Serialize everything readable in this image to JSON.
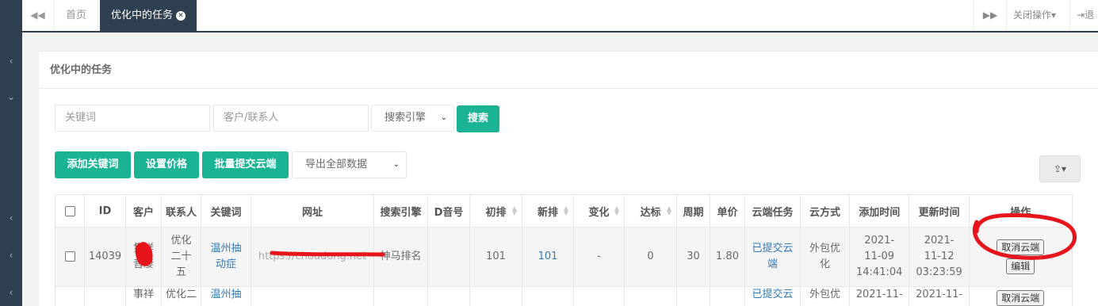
{
  "topbar": {
    "nav_back_icon": "double-left-arrow",
    "tabs": [
      {
        "label": "首页",
        "active": false
      },
      {
        "label": "优化中的任务",
        "active": true,
        "closable": true
      }
    ],
    "nav_forward_icon": "double-right-arrow",
    "close_ops_label": "关闭操作",
    "logout_label": "退"
  },
  "panel": {
    "title": "优化中的任务",
    "search": {
      "keyword_placeholder": "关键词",
      "customer_placeholder": "客户/联系人",
      "engine_select": "搜索引擎",
      "search_button": "搜索"
    },
    "actions": {
      "add_keyword": "添加关键词",
      "set_price": "设置价格",
      "batch_submit": "批量提交云端",
      "export_select": "导出全部数据"
    }
  },
  "table": {
    "headers": [
      "ID",
      "客户",
      "联系人",
      "关键词",
      "网址",
      "搜索引擎",
      "D音号",
      "初排",
      "新排",
      "变化",
      "达标",
      "周期",
      "单价",
      "云端任务",
      "云方式",
      "添加时间",
      "更新时间",
      "操作"
    ],
    "rows": [
      {
        "id": "14039",
        "customer": "隽祥音凄",
        "contact": "优化二十五",
        "keyword": "温州抽动症",
        "url": "https://choudong.net",
        "engine": "神马排名",
        "dyin": "",
        "first_rank": "101",
        "new_rank": "101",
        "change": "-",
        "reached": "0",
        "cycle": "30",
        "price": "1.80",
        "cloud_task": "已提交云端",
        "cloud_mode": "外包优化",
        "added": "2021-11-09 14:41:04",
        "updated": "2021-11-12 03:23:59",
        "op_cancel": "取消云端",
        "op_edit": "编辑"
      },
      {
        "customer": "事祥",
        "contact": "优化二",
        "keyword": "温州抽",
        "cloud_task": "已提交云",
        "cloud_mode": "外包优",
        "added": "2021-11-",
        "updated": "2021-11-",
        "op_cancel": "取消云端"
      }
    ]
  },
  "colors": {
    "sidebar": "#2f4050",
    "primary": "#1ab394",
    "link": "#337ab7",
    "annotation": "#e8141c"
  }
}
